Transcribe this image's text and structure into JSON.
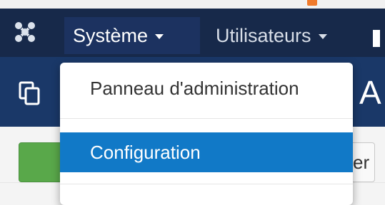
{
  "navbar": {
    "logo_icon": "joomla-logo-icon",
    "items": [
      {
        "label": "Système"
      },
      {
        "label": "Utilisateurs"
      }
    ]
  },
  "subheader": {
    "icon": "copy-icon",
    "title_fragment": ": A"
  },
  "toolbar": {
    "grey_button_fragment": "er"
  },
  "dropdown": {
    "items": [
      {
        "label": "Panneau d'administration"
      },
      {
        "label": "Configuration"
      }
    ]
  },
  "colors": {
    "navbar": "#17294a",
    "subheader": "#1a3868",
    "highlight": "#1179c7",
    "success": "#59a84a"
  }
}
